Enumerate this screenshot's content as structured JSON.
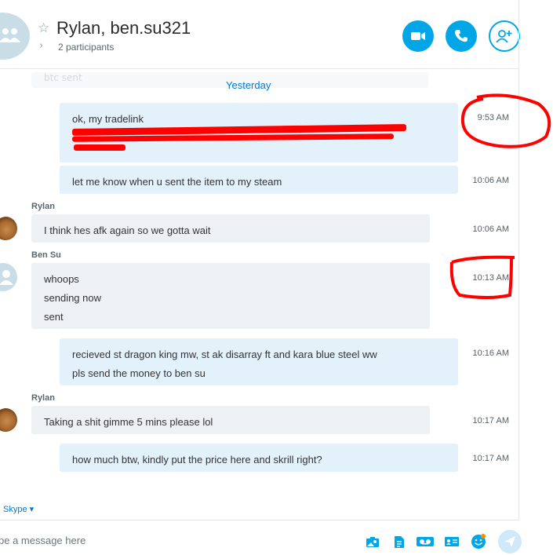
{
  "header": {
    "title": "Rylan, ben.su321",
    "participants": "2 participants"
  },
  "chat": {
    "ghost_text": "btc sent",
    "date_divider": "Yesterday",
    "messages": [
      {
        "lines": [
          "ok, my tradelink"
        ],
        "time": "9:53 AM"
      },
      {
        "lines": [
          "let me know when u sent the item to my steam"
        ],
        "time": "10:06 AM"
      },
      {
        "sender": "Rylan",
        "lines": [
          "I think hes afk again so we gotta wait"
        ],
        "time": "10:06 AM"
      },
      {
        "sender": "Ben Su",
        "lines": [
          "whoops",
          "sending now",
          "sent"
        ],
        "time": "10:13 AM"
      },
      {
        "lines": [
          "recieved st dragon king mw, st ak disarray ft and kara blue steel ww",
          "pls send the money to ben su"
        ],
        "time": "10:16 AM"
      },
      {
        "sender": "Rylan",
        "lines": [
          "Taking a shit gimme 5 mins please lol"
        ],
        "time": "10:17 AM"
      },
      {
        "lines": [
          "how much btw, kindly put the price here and skrill right?"
        ],
        "time": "10:17 AM"
      }
    ]
  },
  "footer": {
    "skype_label": "Skype ▾",
    "placeholder": "pe a message here"
  },
  "colors": {
    "accent": "#00a6e6",
    "outgoing_bubble": "#e3f1fb",
    "incoming_bubble": "#eef1f4",
    "annotation": "#ff0000"
  },
  "icons": [
    "group-avatar-icon",
    "star-icon",
    "chevron-right-icon",
    "video-call-icon",
    "phone-icon",
    "add-person-icon",
    "image-icon",
    "file-icon",
    "video-message-icon",
    "contact-card-icon",
    "emoticon-icon",
    "send-icon"
  ]
}
